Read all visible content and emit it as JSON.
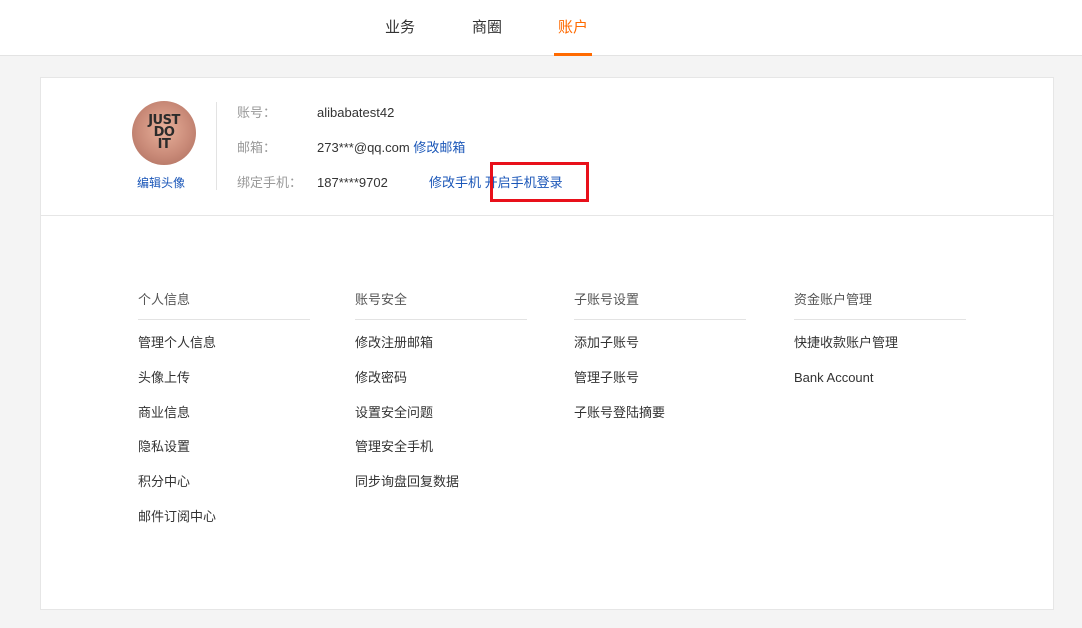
{
  "topnav": {
    "tabs": [
      {
        "label": "业务"
      },
      {
        "label": "商圈"
      },
      {
        "label": "账户"
      }
    ],
    "active_tab": "账户",
    "accent_color": "#ff6a00"
  },
  "profile": {
    "avatar_icon": "avatar-image",
    "avatar_text": "JUST DO IT",
    "edit_avatar_label": "编辑头像",
    "account_label": "账号：",
    "account_value": "alibabatest42",
    "email_label": "邮箱：",
    "email_value": "273***@qq.com",
    "edit_email_link": "修改邮箱",
    "phone_label": "绑定手机：",
    "phone_value": "187****9702",
    "edit_phone_link": "修改手机",
    "enable_phone_login_link": "开启手机登录",
    "highlight_color": "#e8101a"
  },
  "sections": [
    {
      "title": "个人信息",
      "items": [
        "管理个人信息",
        "头像上传",
        "商业信息",
        "隐私设置",
        "积分中心",
        "邮件订阅中心"
      ]
    },
    {
      "title": "账号安全",
      "items": [
        "修改注册邮箱",
        "修改密码",
        "设置安全问题",
        "管理安全手机",
        "同步询盘回复数据"
      ]
    },
    {
      "title": "子账号设置",
      "items": [
        "添加子账号",
        "管理子账号",
        "子账号登陆摘要"
      ]
    },
    {
      "title": "资金账户管理",
      "items": [
        "快捷收款账户管理",
        "Bank Account"
      ]
    }
  ]
}
